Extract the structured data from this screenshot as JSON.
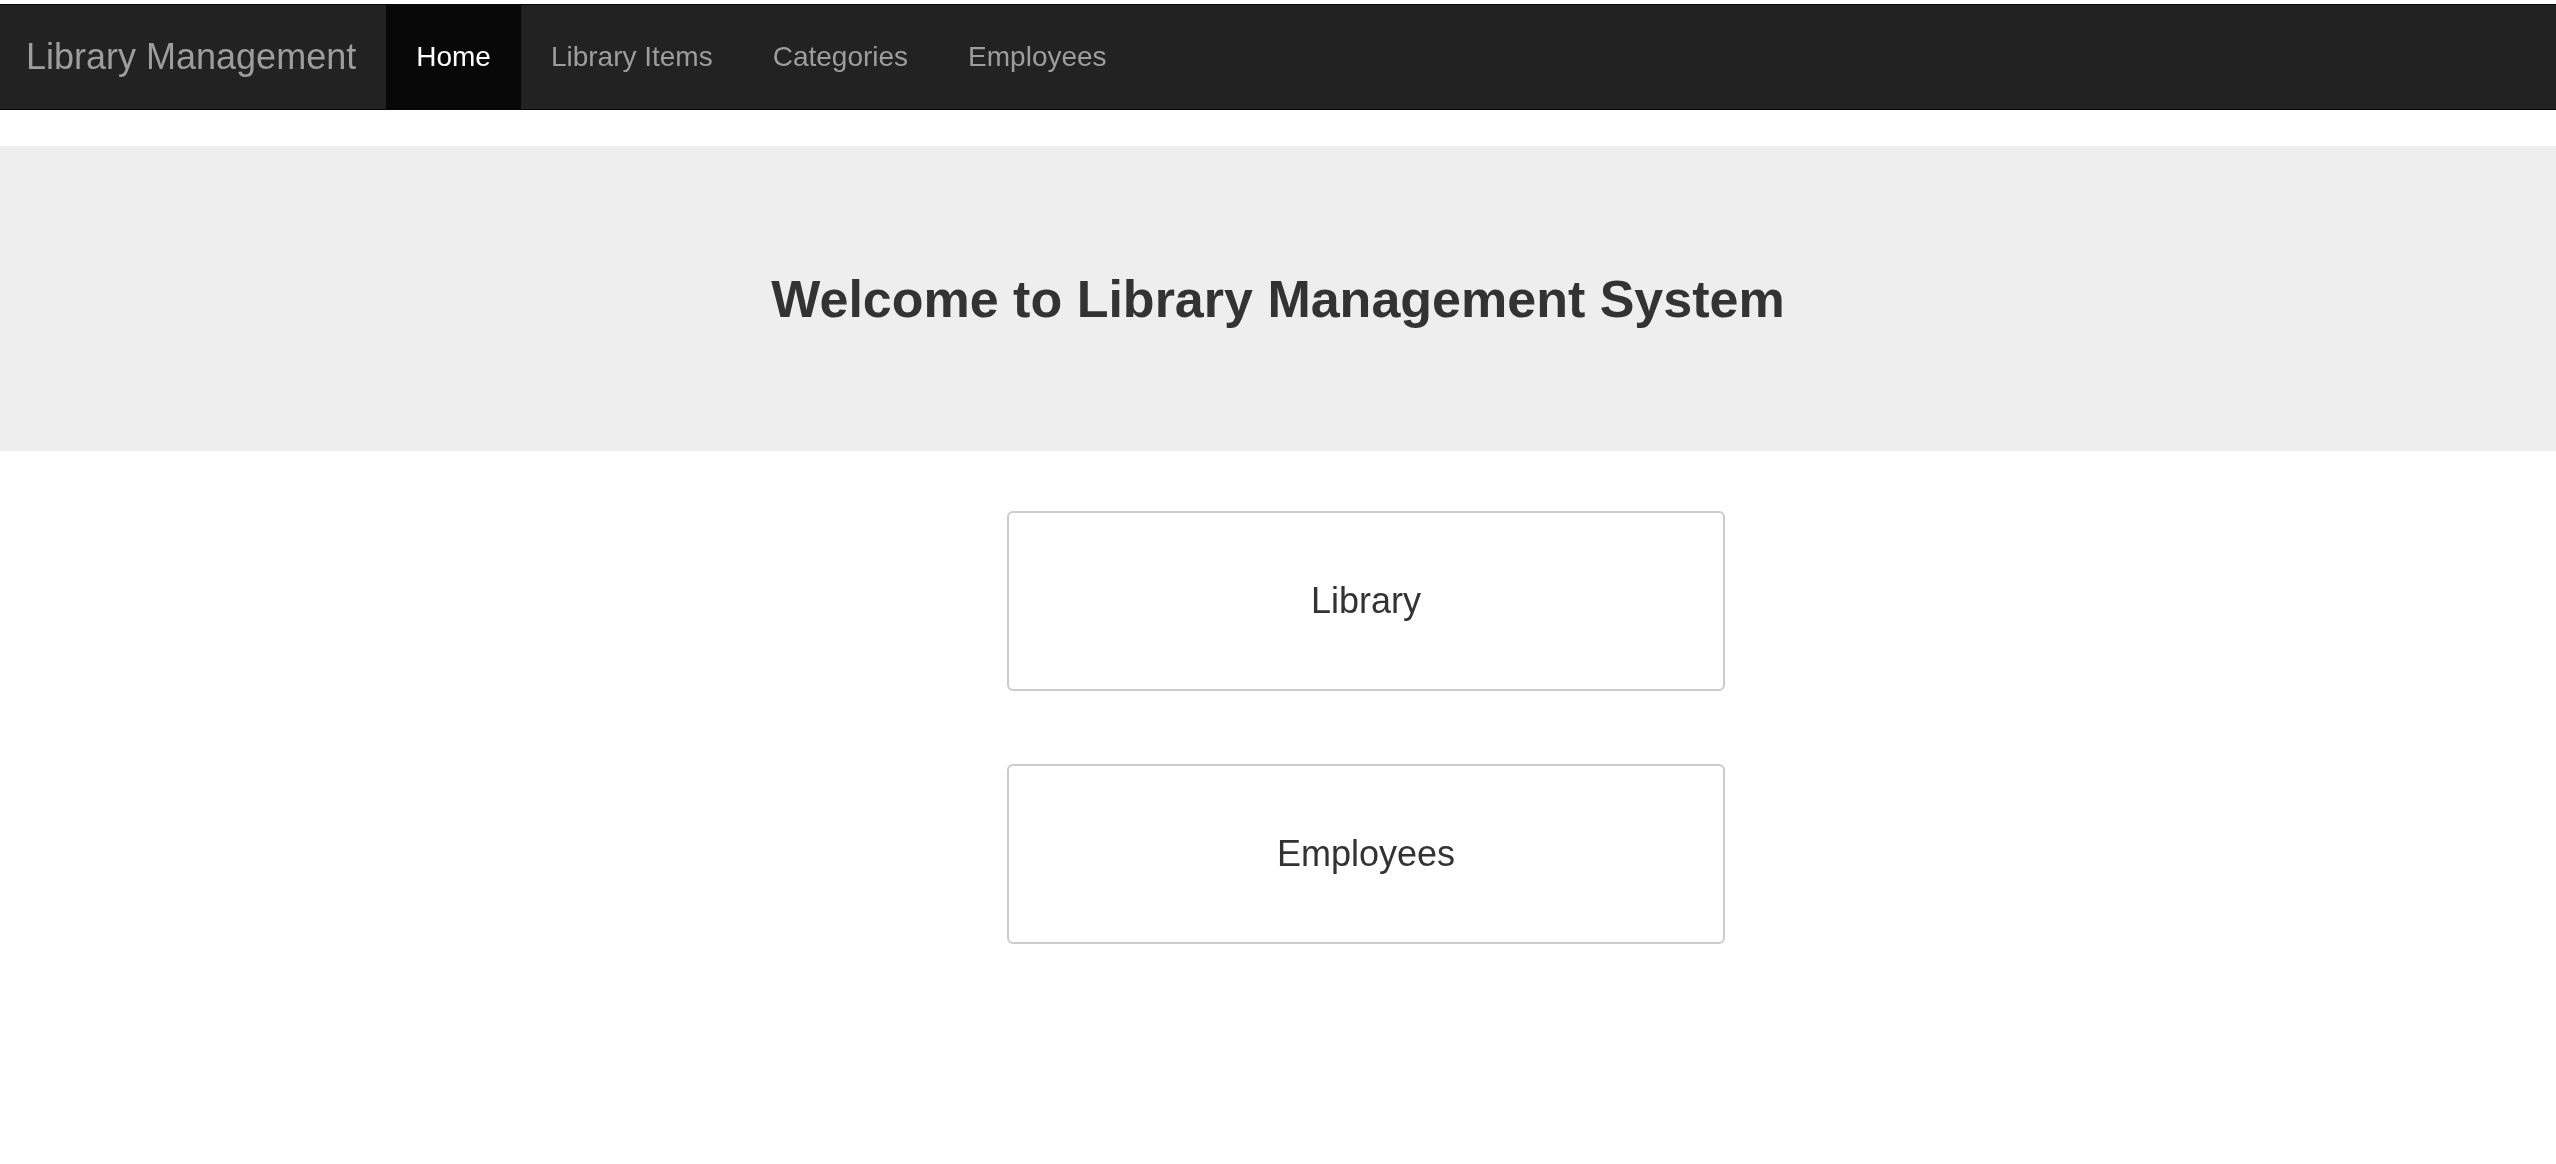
{
  "navbar": {
    "brand": "Library Management",
    "items": [
      {
        "label": "Home",
        "selected": true
      },
      {
        "label": "Library Items",
        "selected": false
      },
      {
        "label": "Categories",
        "selected": false
      },
      {
        "label": "Employees",
        "selected": false
      }
    ]
  },
  "banner": {
    "heading": "Welcome to Library Management System"
  },
  "cards": [
    {
      "label": "Library"
    },
    {
      "label": "Employees"
    }
  ]
}
